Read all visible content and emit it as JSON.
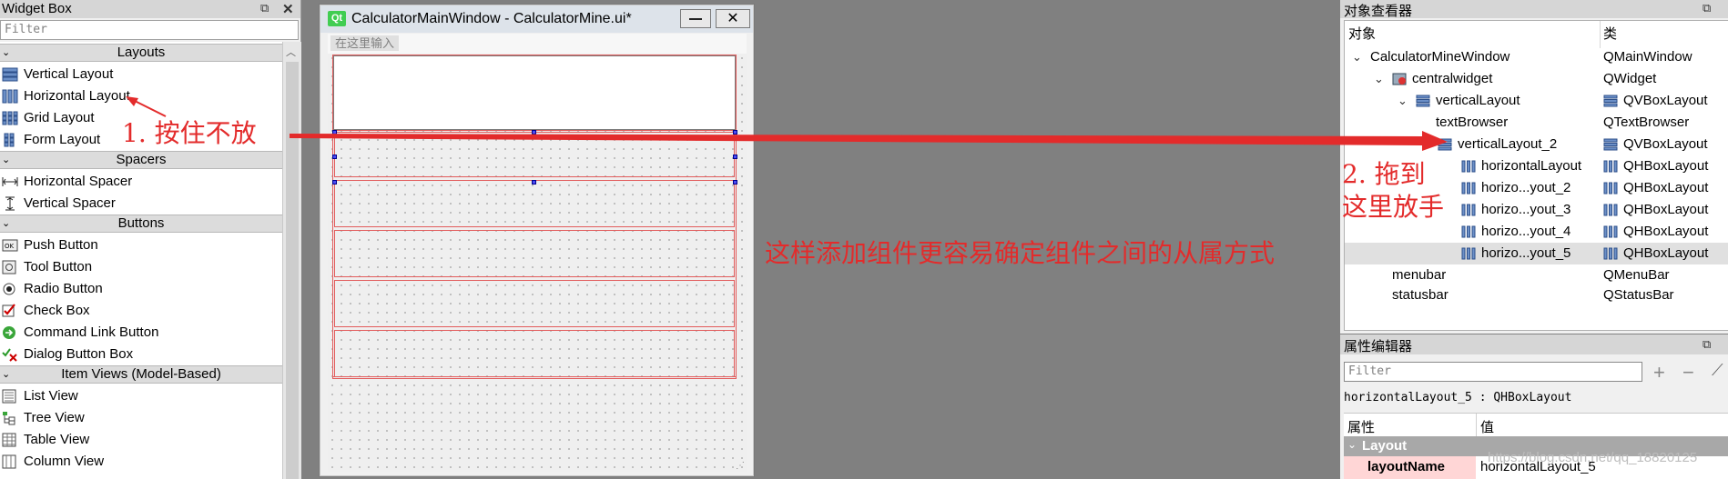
{
  "widget_box": {
    "title": "Widget Box",
    "filter_placeholder": "Filter",
    "categories": {
      "layouts": "Layouts",
      "spacers": "Spacers",
      "buttons": "Buttons",
      "item_views": "Item Views (Model-Based)"
    },
    "items": {
      "vertical_layout": "Vertical Layout",
      "horizontal_layout": "Horizontal Layout",
      "grid_layout": "Grid Layout",
      "form_layout": "Form Layout",
      "horizontal_spacer": "Horizontal Spacer",
      "vertical_spacer": "Vertical Spacer",
      "push_button": "Push Button",
      "tool_button": "Tool Button",
      "radio_button": "Radio Button",
      "check_box": "Check Box",
      "command_link_button": "Command Link Button",
      "dialog_button_box": "Dialog Button Box",
      "list_view": "List View",
      "tree_view": "Tree View",
      "table_view": "Table View",
      "column_view": "Column View"
    }
  },
  "form_window": {
    "logo": "Qt",
    "title": "CalculatorMainWindow - CalculatorMine.ui*",
    "menu_hint": "在这里输入"
  },
  "object_inspector": {
    "title": "对象查看器",
    "col_object": "对象",
    "col_class": "类",
    "rows": [
      {
        "name": "CalculatorMineWindow",
        "cls": "QMainWindow"
      },
      {
        "name": "centralwidget",
        "cls": "QWidget"
      },
      {
        "name": "verticalLayout",
        "cls": "QVBoxLayout"
      },
      {
        "name": "textBrowser",
        "cls": "QTextBrowser"
      },
      {
        "name": "verticalLayout_2",
        "cls": "QVBoxLayout"
      },
      {
        "name": "horizontalLayout",
        "cls": "QHBoxLayout"
      },
      {
        "name": "horizo...yout_2",
        "cls": "QHBoxLayout"
      },
      {
        "name": "horizo...yout_3",
        "cls": "QHBoxLayout"
      },
      {
        "name": "horizo...yout_4",
        "cls": "QHBoxLayout"
      },
      {
        "name": "horizo...yout_5",
        "cls": "QHBoxLayout"
      },
      {
        "name": "menubar",
        "cls": "QMenuBar"
      },
      {
        "name": "statusbar",
        "cls": "QStatusBar"
      }
    ]
  },
  "property_editor": {
    "title": "属性编辑器",
    "filter_placeholder": "Filter",
    "object_line": "horizontalLayout_5 : QHBoxLayout",
    "col_property": "属性",
    "col_value": "值",
    "group": "Layout",
    "row_name": "layoutName",
    "row_value": "horizontalLayout_5"
  },
  "watermark": "https://blog.csdn.net/qq_18820125",
  "annotations": {
    "step1": "1.  按住不放",
    "step2_line1": "2.  拖到",
    "step2_line2": "这里放手",
    "note": "这样添加组件更容易确定组件之间的从属方式",
    "color": "#e32b2b"
  }
}
